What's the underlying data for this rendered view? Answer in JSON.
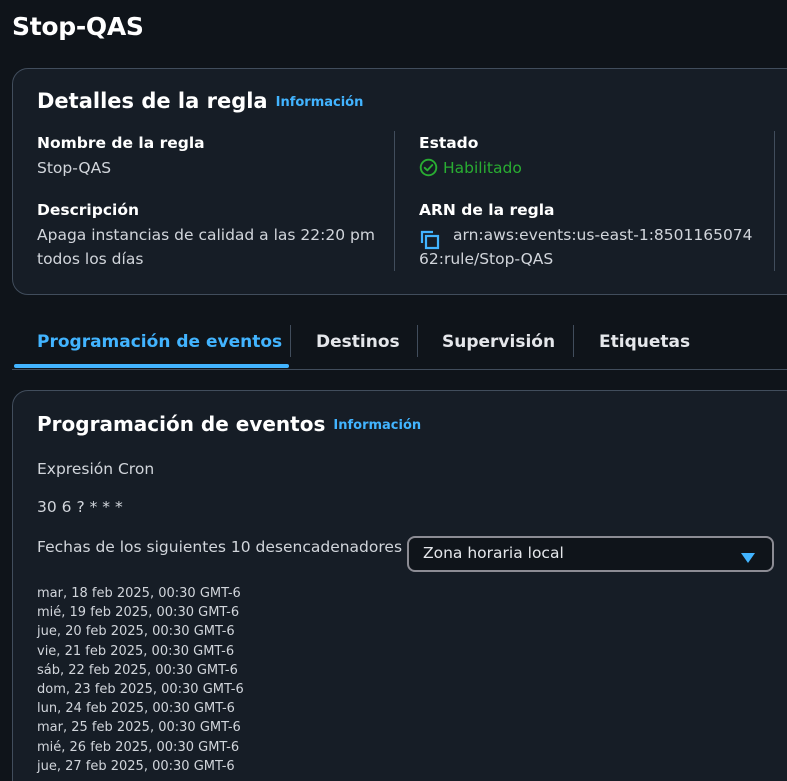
{
  "page": {
    "title": "Stop-QAS"
  },
  "rule_details": {
    "heading": "Detalles de la regla",
    "info_label": "Información",
    "name": {
      "label": "Nombre de la regla",
      "value": "Stop-QAS"
    },
    "description": {
      "label": "Descripción",
      "line1": "Apaga instancias de calidad a las 22:20 pm",
      "line2": "todos los días"
    },
    "status": {
      "label": "Estado",
      "value": "Habilitado",
      "color": "#29ad32"
    },
    "arn": {
      "label": "ARN de la regla",
      "line1": "arn:aws:events:us-east-1:8501165074",
      "line2": "62:rule/Stop-QAS"
    }
  },
  "tabs": [
    {
      "label": "Programación de eventos",
      "active": true
    },
    {
      "label": "Destinos",
      "active": false
    },
    {
      "label": "Supervisión",
      "active": false
    },
    {
      "label": "Etiquetas",
      "active": false
    }
  ],
  "schedule": {
    "heading": "Programación de eventos",
    "info_label": "Información",
    "cron_label": "Expresión Cron",
    "cron_value": "30 6 ? * * *",
    "next_triggers_label": "Fechas de los siguientes 10 desencadenadores",
    "timezone_select": {
      "value": "Zona horaria local"
    },
    "dates": [
      "mar, 18 feb 2025, 00:30 GMT-6",
      "mié, 19 feb 2025, 00:30 GMT-6",
      "jue, 20 feb 2025, 00:30 GMT-6",
      "vie, 21 feb 2025, 00:30 GMT-6",
      "sáb, 22 feb 2025, 00:30 GMT-6",
      "dom, 23 feb 2025, 00:30 GMT-6",
      "lun, 24 feb 2025, 00:30 GMT-6",
      "mar, 25 feb 2025, 00:30 GMT-6",
      "mié, 26 feb 2025, 00:30 GMT-6",
      "jue, 27 feb 2025, 00:30 GMT-6"
    ]
  },
  "colors": {
    "accent": "#42b4ff",
    "success": "#29ad32",
    "background": "#0f141a",
    "card": "#161d26"
  },
  "icons": [
    "check-circle-icon",
    "copy-icon",
    "caret-down-icon"
  ]
}
